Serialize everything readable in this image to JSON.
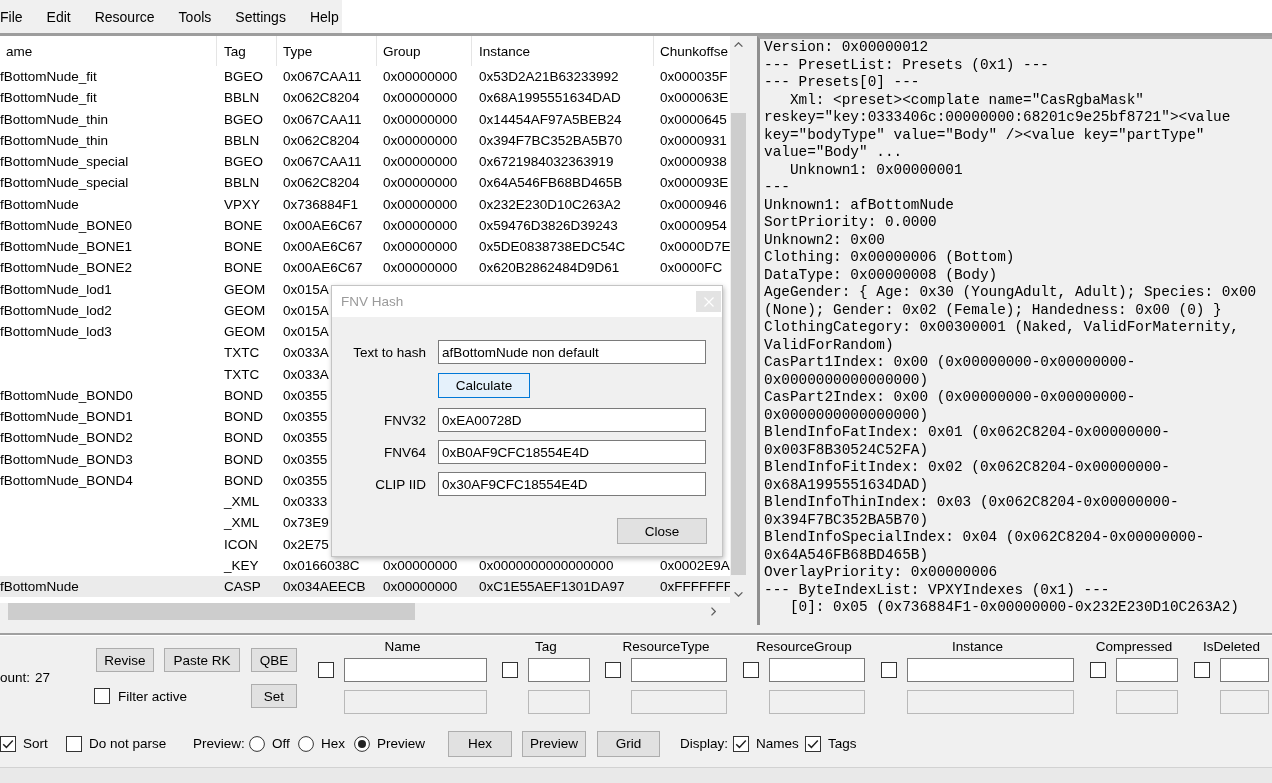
{
  "menu": [
    "File",
    "Edit",
    "Resource",
    "Tools",
    "Settings",
    "Help"
  ],
  "resource_table": {
    "columns": [
      "ame",
      "Tag",
      "Type",
      "Group",
      "Instance",
      "Chunkoffse"
    ],
    "rows": [
      {
        "column_1": "fBottomNude_fit",
        "column_2": "BGEO",
        "column_3": "0x067CAA11",
        "column_4": "0x00000000",
        "column_5": "0x53D2A21B63233992",
        "column_6": "0x000035F",
        "selected": false
      },
      {
        "column_1": "fBottomNude_fit",
        "column_2": "BBLN",
        "column_3": "0x062C8204",
        "column_4": "0x00000000",
        "column_5": "0x68A1995551634DAD",
        "column_6": "0x000063E",
        "selected": false
      },
      {
        "column_1": "fBottomNude_thin",
        "column_2": "BGEO",
        "column_3": "0x067CAA11",
        "column_4": "0x00000000",
        "column_5": "0x14454AF97A5BEB24",
        "column_6": "0x0000645",
        "selected": false
      },
      {
        "column_1": "fBottomNude_thin",
        "column_2": "BBLN",
        "column_3": "0x062C8204",
        "column_4": "0x00000000",
        "column_5": "0x394F7BC352BA5B70",
        "column_6": "0x0000931",
        "selected": false
      },
      {
        "column_1": "fBottomNude_special",
        "column_2": "BGEO",
        "column_3": "0x067CAA11",
        "column_4": "0x00000000",
        "column_5": "0x6721984032363919",
        "column_6": "0x0000938",
        "selected": false
      },
      {
        "column_1": "fBottomNude_special",
        "column_2": "BBLN",
        "column_3": "0x062C8204",
        "column_4": "0x00000000",
        "column_5": "0x64A546FB68BD465B",
        "column_6": "0x000093E",
        "selected": false
      },
      {
        "column_1": "fBottomNude",
        "column_2": "VPXY",
        "column_3": "0x736884F1",
        "column_4": "0x00000000",
        "column_5": "0x232E230D10C263A2",
        "column_6": "0x0000946",
        "selected": false
      },
      {
        "column_1": "fBottomNude_BONE0",
        "column_2": "BONE",
        "column_3": "0x00AE6C67",
        "column_4": "0x00000000",
        "column_5": "0x59476D3826D39243",
        "column_6": "0x0000954",
        "selected": false
      },
      {
        "column_1": "fBottomNude_BONE1",
        "column_2": "BONE",
        "column_3": "0x00AE6C67",
        "column_4": "0x00000000",
        "column_5": "0x5DE0838738EDC54C",
        "column_6": "0x0000D7E",
        "selected": false
      },
      {
        "column_1": "fBottomNude_BONE2",
        "column_2": "BONE",
        "column_3": "0x00AE6C67",
        "column_4": "0x00000000",
        "column_5": "0x620B2862484D9D61",
        "column_6": "0x0000FC",
        "selected": false
      },
      {
        "column_1": "fBottomNude_lod1",
        "column_2": "GEOM",
        "column_3": "0x015A",
        "selected": false
      },
      {
        "column_1": "fBottomNude_lod2",
        "column_2": "GEOM",
        "column_3": "0x015A",
        "selected": false
      },
      {
        "column_1": "fBottomNude_lod3",
        "column_2": "GEOM",
        "column_3": "0x015A",
        "selected": false
      },
      {
        "column_2": "TXTC",
        "column_3": "0x033A",
        "selected": false
      },
      {
        "column_2": "TXTC",
        "column_3": "0x033A",
        "selected": false
      },
      {
        "column_1": "fBottomNude_BOND0",
        "column_2": "BOND",
        "column_3": "0x0355",
        "selected": false
      },
      {
        "column_1": "fBottomNude_BOND1",
        "column_2": "BOND",
        "column_3": "0x0355",
        "selected": false
      },
      {
        "column_1": "fBottomNude_BOND2",
        "column_2": "BOND",
        "column_3": "0x0355",
        "selected": false
      },
      {
        "column_1": "fBottomNude_BOND3",
        "column_2": "BOND",
        "column_3": "0x0355",
        "selected": false
      },
      {
        "column_1": "fBottomNude_BOND4",
        "column_2": "BOND",
        "column_3": "0x0355",
        "selected": false
      },
      {
        "column_2": "_XML",
        "column_3": "0x0333",
        "selected": false
      },
      {
        "column_2": "_XML",
        "column_3": "0x73E9",
        "selected": false
      },
      {
        "column_2": "ICON",
        "column_3": "0x2E75",
        "selected": false
      },
      {
        "column_2": "_KEY",
        "column_3": "0x0166038C",
        "column_4": "0x00000000",
        "column_5": "0x0000000000000000",
        "column_6": "0x0002E9A",
        "selected": false
      },
      {
        "column_1": "fBottomNude",
        "column_2": "CASP",
        "column_3": "0x034AEECB",
        "column_4": "0x00000000",
        "column_5": "0xC1E55AEF1301DA97",
        "column_6": "0xFFFFFFF",
        "selected": true
      }
    ]
  },
  "preview": {
    "lines": [
      "Version: 0x00000012",
      "--- PresetList: Presets (0x1) ---",
      "--- Presets[0] ---",
      "   Xml: <preset><complate name=\"CasRgbaMask\"",
      "reskey=\"key:0333406c:00000000:68201c9e25bf8721\"><value",
      "key=\"bodyType\" value=\"Body\" /><value key=\"partType\"",
      "value=\"Body\" ...",
      "   Unknown1: 0x00000001",
      "---",
      "Unknown1: afBottomNude",
      "SortPriority: 0.0000",
      "Unknown2: 0x00",
      "Clothing: 0x00000006 (Bottom)",
      "DataType: 0x00000008 (Body)",
      "AgeGender: { Age: 0x30 (YoungAdult, Adult); Species: 0x00",
      "(None); Gender: 0x02 (Female); Handedness: 0x00 (0) }",
      "ClothingCategory: 0x00300001 (Naked, ValidForMaternity,",
      "ValidForRandom)",
      "CasPart1Index: 0x00 (0x00000000-0x00000000-",
      "0x0000000000000000)",
      "CasPart2Index: 0x00 (0x00000000-0x00000000-",
      "0x0000000000000000)",
      "BlendInfoFatIndex: 0x01 (0x062C8204-0x00000000-",
      "0x003F8B30524C52FA)",
      "BlendInfoFitIndex: 0x02 (0x062C8204-0x00000000-",
      "0x68A1995551634DAD)",
      "BlendInfoThinIndex: 0x03 (0x062C8204-0x00000000-",
      "0x394F7BC352BA5B70)",
      "BlendInfoSpecialIndex: 0x04 (0x062C8204-0x00000000-",
      "0x64A546FB68BD465B)",
      "OverlayPriority: 0x00000006",
      "--- ByteIndexList: VPXYIndexes (0x1) ---",
      "   [0]: 0x05 (0x736884F1-0x00000000-0x232E230D10C263A2)"
    ]
  },
  "dialog": {
    "title": "FNV Hash",
    "active": false,
    "rows": [
      {
        "kind": "field",
        "label": "Text to hash",
        "value": "afBottomNude non default"
      },
      {
        "kind": "button",
        "label": "Calculate",
        "focused": true
      },
      {
        "kind": "field",
        "label": "FNV32",
        "value": "0xEA00728D"
      },
      {
        "kind": "field",
        "label": "FNV64",
        "value": "0xB0AF9CFC18554E4D"
      },
      {
        "kind": "field",
        "label": "CLIP IID",
        "value": "0x30AF9CFC18554E4D"
      }
    ],
    "buttons": [
      {
        "label": "Close",
        "focused": false
      }
    ]
  },
  "filter_panel": {
    "count_label": "ount:",
    "count": "27",
    "actions": [
      "Revise",
      "Paste RK",
      "QBE"
    ],
    "filter_active": {
      "label": "Filter active",
      "checked": false
    },
    "set_button": "Set",
    "filters": [
      {
        "label": "Name",
        "checked": false,
        "fields": [
          {
            "disabled": false
          },
          {
            "disabled": true
          }
        ]
      },
      {
        "label": "Tag",
        "checked": false,
        "fields": [
          {
            "disabled": false
          },
          {
            "disabled": true
          }
        ]
      },
      {
        "label": "ResourceType",
        "checked": false,
        "fields": [
          {
            "disabled": false
          },
          {
            "disabled": true
          }
        ]
      },
      {
        "label": "ResourceGroup",
        "checked": false,
        "fields": [
          {
            "disabled": false
          },
          {
            "disabled": true
          }
        ]
      },
      {
        "label": "Instance",
        "checked": false,
        "fields": [
          {
            "disabled": false
          },
          {
            "disabled": true
          }
        ]
      },
      {
        "label": "Compressed",
        "checked": false,
        "fields": [
          {
            "disabled": false
          },
          {
            "disabled": true
          }
        ]
      },
      {
        "label": "IsDeleted",
        "checked": false,
        "fields": [
          {
            "disabled": false
          },
          {
            "disabled": true
          }
        ]
      }
    ]
  },
  "options_bar": {
    "checkboxes": [
      {
        "label": "Sort",
        "checked": true
      },
      {
        "label": "Do not parse",
        "checked": false
      }
    ],
    "preview_label": "Preview:",
    "preview_modes": [
      {
        "label": "Off",
        "selected": false
      },
      {
        "label": "Hex",
        "selected": false
      },
      {
        "label": "Preview",
        "selected": true
      }
    ],
    "view_buttons": [
      "Hex",
      "Preview",
      "Grid"
    ],
    "display_label": "Display:",
    "display_options": [
      {
        "label": "Names",
        "checked": true
      },
      {
        "label": "Tags",
        "checked": true
      }
    ]
  }
}
